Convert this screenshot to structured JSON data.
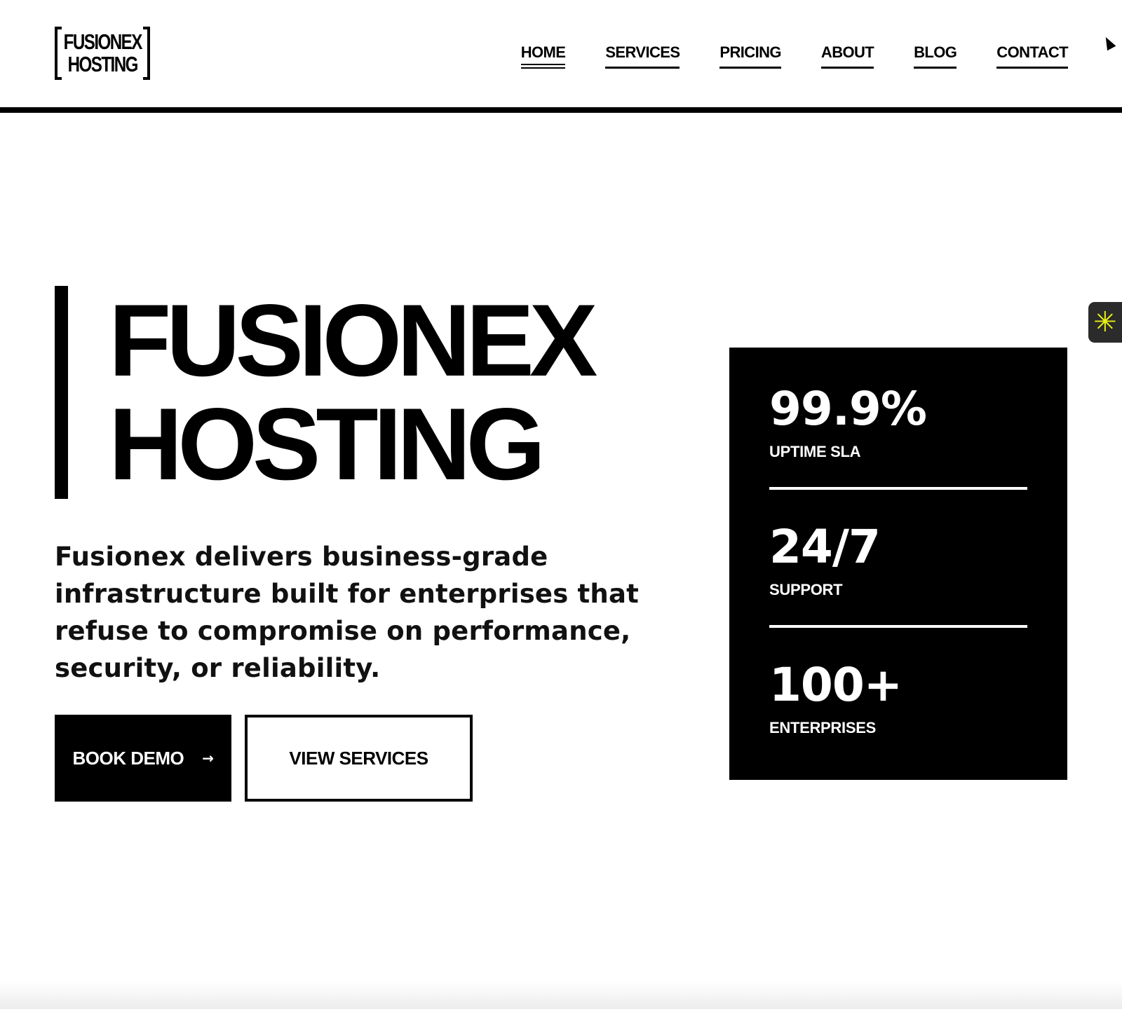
{
  "header": {
    "logo_line1": "FUSIONEX",
    "logo_line2": "HOSTING",
    "nav": [
      {
        "label": "HOME",
        "active": true
      },
      {
        "label": "SERVICES",
        "active": false
      },
      {
        "label": "PRICING",
        "active": false
      },
      {
        "label": "ABOUT",
        "active": false
      },
      {
        "label": "BLOG",
        "active": false
      },
      {
        "label": "CONTACT",
        "active": false
      }
    ]
  },
  "hero": {
    "title_line1": "FUSIONEX",
    "title_line2": "HOSTING",
    "description": "Fusionex delivers business-grade infrastructure built for enterprises that refuse to compromise on performance, security, or reliability.",
    "primary_button": {
      "label": "BOOK DEMO",
      "icon": "arrow-right-icon"
    },
    "secondary_button": {
      "label": "VIEW SERVICES"
    }
  },
  "stats": [
    {
      "value": "99.9%",
      "label": "UPTIME SLA"
    },
    {
      "value": "24/7",
      "label": "SUPPORT"
    },
    {
      "value": "100+",
      "label": "ENTERPRISES"
    }
  ],
  "side_widget": {
    "icon": "asterisk-icon",
    "color": "#e8f213"
  },
  "colors": {
    "background": "#ffffff",
    "foreground": "#000000",
    "widget_background": "#2b2b2b"
  }
}
